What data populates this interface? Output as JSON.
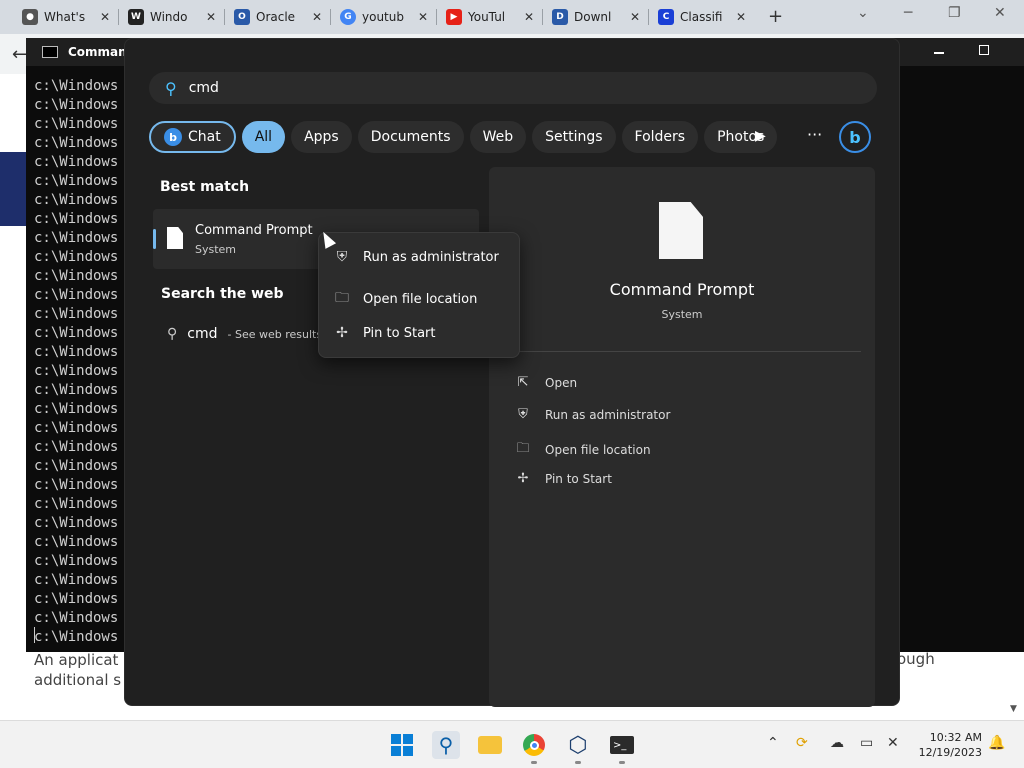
{
  "browser": {
    "tabs": [
      {
        "title": "What's",
        "favicon": "chrome-icon",
        "color": "#555555"
      },
      {
        "title": "Windo",
        "favicon": "wiki-icon",
        "color": "#222222"
      },
      {
        "title": "Oracle",
        "favicon": "oracle-icon",
        "color": "#2a5aa8"
      },
      {
        "title": "youtub",
        "favicon": "google-icon",
        "color": "#4285f4"
      },
      {
        "title": "YouTul",
        "favicon": "youtube-icon",
        "color": "#e62117"
      },
      {
        "title": "Downl",
        "favicon": "download-icon",
        "color": "#2a5aa8"
      },
      {
        "title": "Classifi",
        "favicon": "classifier-icon",
        "color": "#1a3fd6"
      }
    ],
    "new_tab": "+",
    "page_text_line1": "An applicat",
    "page_text_line2": "additional s",
    "page_text_right": "ough"
  },
  "cmd": {
    "title": "Command",
    "prompt_line": "c:\\Windows",
    "line_count": 30
  },
  "search": {
    "query": "cmd",
    "filters": [
      "Chat",
      "All",
      "Apps",
      "Documents",
      "Web",
      "Settings",
      "Folders",
      "Photos"
    ],
    "active_filter": "All",
    "best_match_heading": "Best match",
    "best_match": {
      "name": "Command Prompt",
      "type": "System"
    },
    "search_web_heading": "Search the web",
    "web_result": {
      "query": "cmd",
      "suffix": "- See web results"
    },
    "detail": {
      "title": "Command Prompt",
      "subtitle": "System",
      "actions": [
        "Open",
        "Run as administrator",
        "Open file location",
        "Pin to Start"
      ]
    }
  },
  "context_menu": {
    "items": [
      "Run as administrator",
      "Open file location",
      "Pin to Start"
    ]
  },
  "taskbar": {
    "time": "10:32 AM",
    "date": "12/19/2023"
  },
  "colors": {
    "accent": "#76b9ed",
    "panel_bg": "#202020",
    "pane_bg": "#2b2b2b",
    "taskbar_bg": "#f2f2f2"
  }
}
